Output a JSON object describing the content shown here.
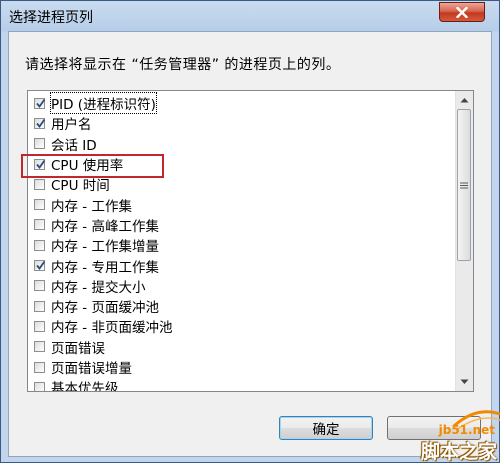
{
  "window": {
    "title": "选择进程页列"
  },
  "dialog": {
    "prompt": "请选择将显示在 “任务管理器” 的进程页上的列。",
    "items": [
      {
        "label": "PID (进程标识符)",
        "checked": true,
        "focused": true
      },
      {
        "label": "用户名",
        "checked": true,
        "focused": false
      },
      {
        "label": "会话 ID",
        "checked": false,
        "focused": false
      },
      {
        "label": "CPU 使用率",
        "checked": true,
        "focused": false
      },
      {
        "label": "CPU 时间",
        "checked": false,
        "focused": false
      },
      {
        "label": "内存 - 工作集",
        "checked": false,
        "focused": false
      },
      {
        "label": "内存 - 高峰工作集",
        "checked": false,
        "focused": false
      },
      {
        "label": "内存 - 工作集增量",
        "checked": false,
        "focused": false
      },
      {
        "label": "内存 - 专用工作集",
        "checked": true,
        "focused": false
      },
      {
        "label": "内存 - 提交大小",
        "checked": false,
        "focused": false
      },
      {
        "label": "内存 - 页面缓冲池",
        "checked": false,
        "focused": false
      },
      {
        "label": "内存 - 非页面缓冲池",
        "checked": false,
        "focused": false
      },
      {
        "label": "页面错误",
        "checked": false,
        "focused": false
      },
      {
        "label": "页面错误增量",
        "checked": false,
        "focused": false
      },
      {
        "label": "基本优先级",
        "checked": false,
        "focused": false
      }
    ],
    "ok_label": "确定",
    "highlighted_item": "CPU 使用率"
  },
  "watermark": {
    "url": "jb51.net",
    "name": "脚本之家"
  },
  "colors": {
    "highlight": "#c0282d",
    "close": "#c23a21",
    "watermark_orange": "#f28a00"
  }
}
